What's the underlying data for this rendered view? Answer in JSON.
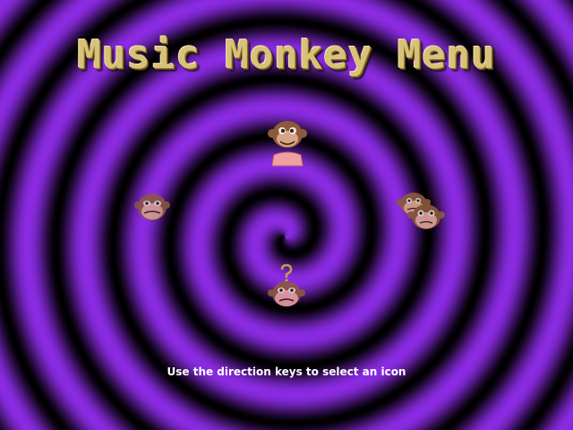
{
  "title": "Music Monkey Menu",
  "hint": "Use the direction keys to select an icon",
  "colors": {
    "spiral_purple": "#8a2be2",
    "spiral_dark": "#000000",
    "title_gold": "#d8c27a",
    "hint_text": "#ffffff",
    "monkey_brown": "#8b5a3c",
    "monkey_face": "#d9a58a",
    "shirt_pink": "#f0a0a0",
    "question_mark": "#c8b040"
  },
  "menu_icons": [
    {
      "name": "monkey-with-shirt-icon",
      "position": "top"
    },
    {
      "name": "monkey-face-icon",
      "position": "left"
    },
    {
      "name": "two-monkeys-icon",
      "position": "right"
    },
    {
      "name": "monkey-question-icon",
      "position": "bottom"
    }
  ]
}
